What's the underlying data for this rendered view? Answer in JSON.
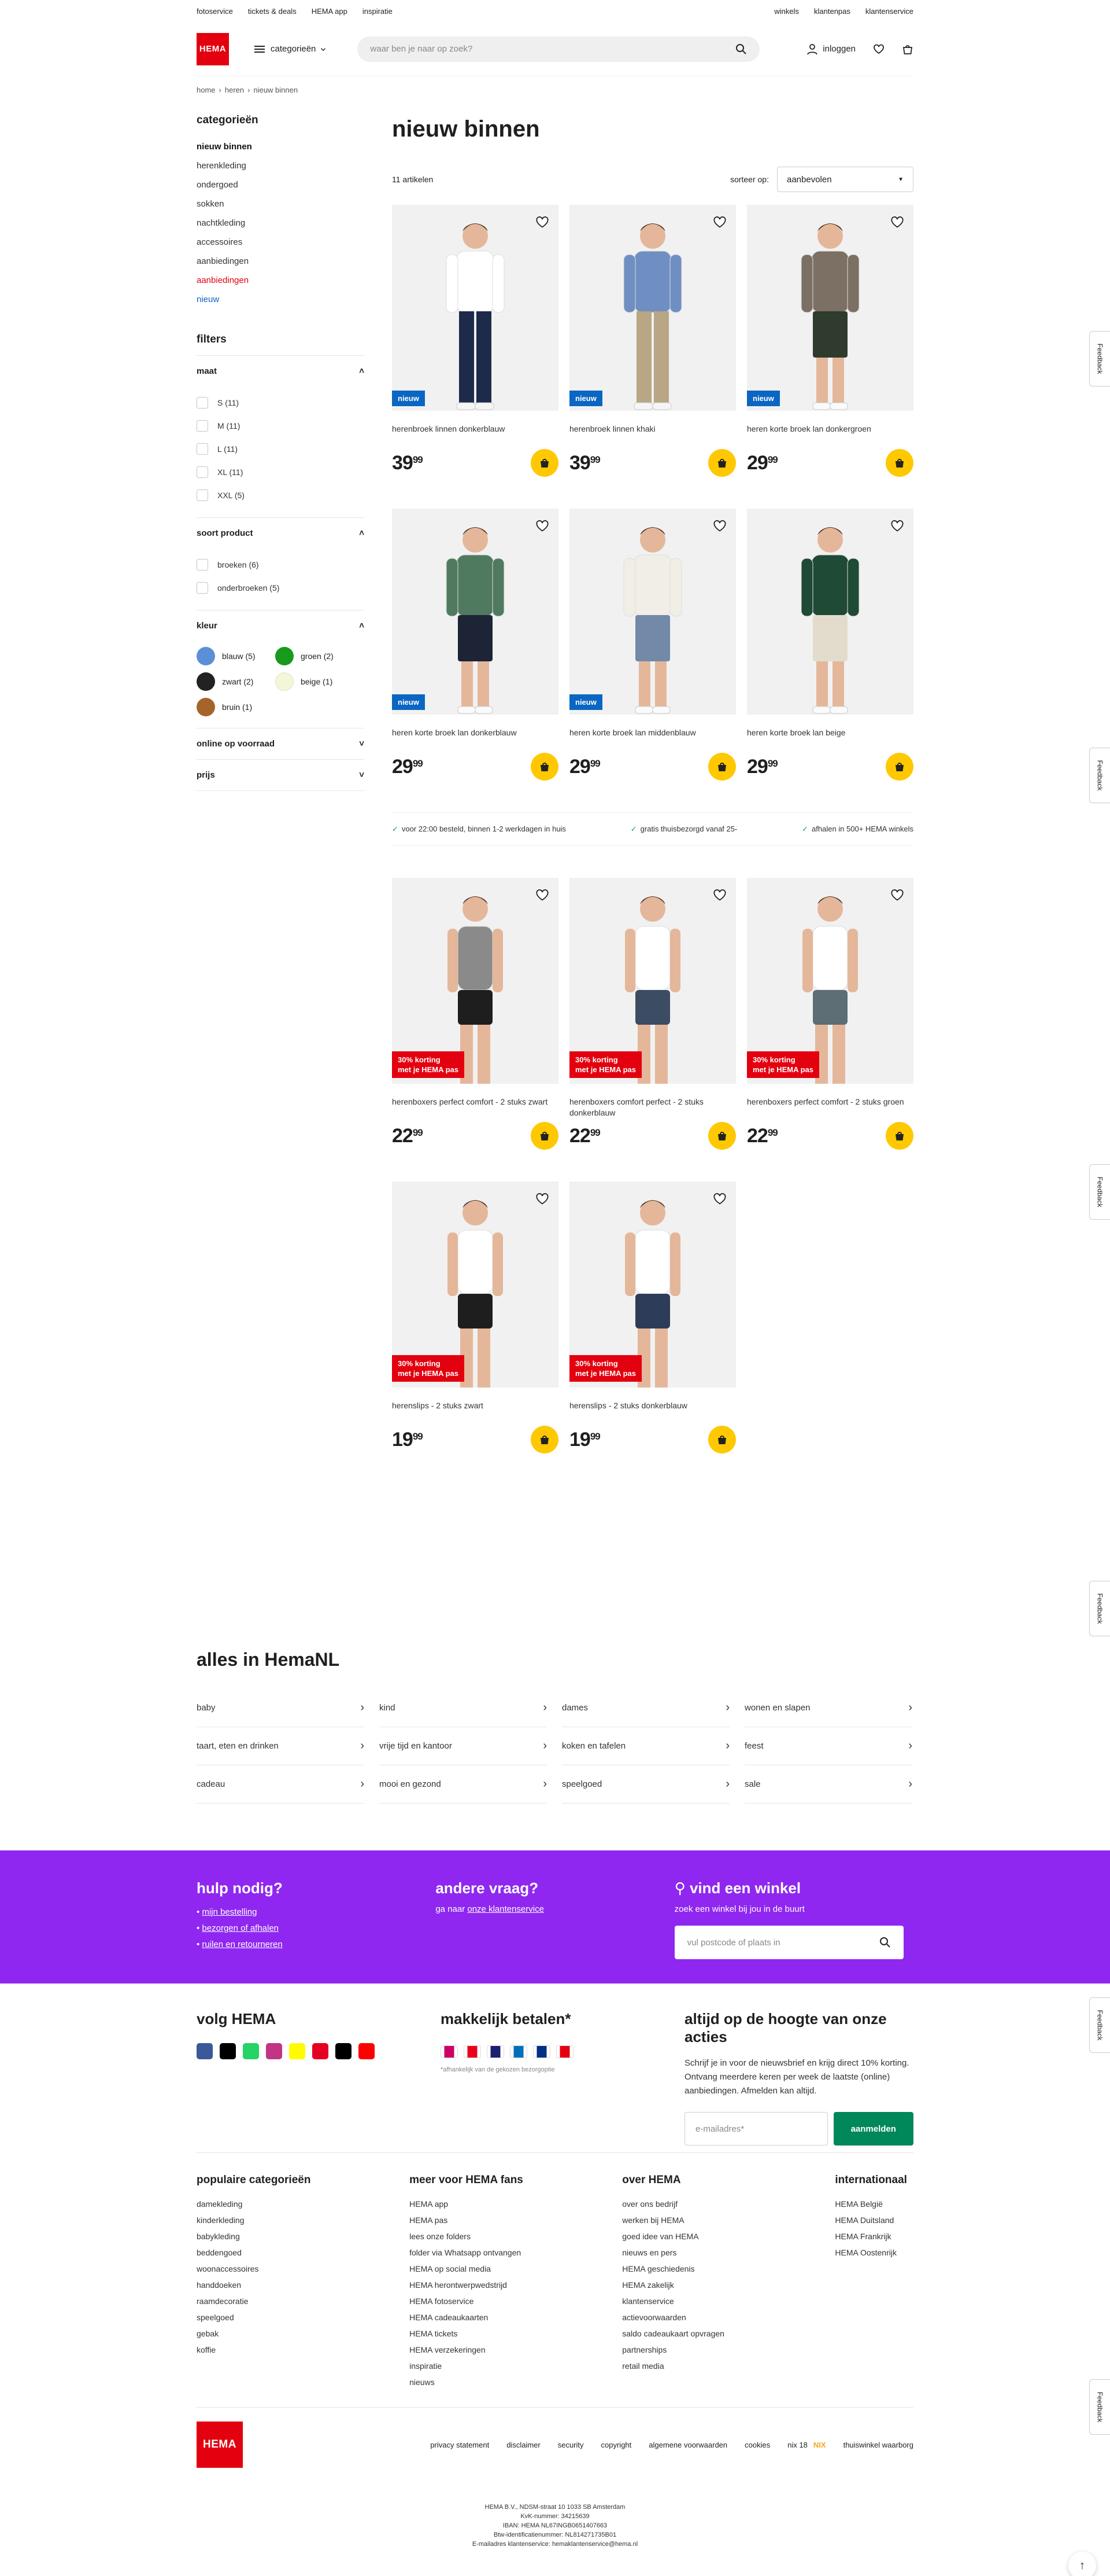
{
  "topbar": {
    "left": [
      "fotoservice",
      "tickets & deals",
      "HEMA app",
      "inspiratie"
    ],
    "right": [
      "winkels",
      "klantenpas",
      "klantenservice"
    ]
  },
  "header": {
    "logo": "HEMA",
    "categories_label": "categorieën",
    "search_placeholder": "waar ben je naar op zoek?",
    "login_label": "inloggen"
  },
  "breadcrumb": [
    "home",
    "heren",
    "nieuw binnen"
  ],
  "sidebar": {
    "title": "categorieën",
    "items": [
      {
        "label": "nieuw binnen",
        "style": "active"
      },
      {
        "label": "herenkleding",
        "style": ""
      },
      {
        "label": "ondergoed",
        "style": ""
      },
      {
        "label": "sokken",
        "style": ""
      },
      {
        "label": "nachtkleding",
        "style": ""
      },
      {
        "label": "accessoires",
        "style": ""
      },
      {
        "label": "aanbiedingen",
        "style": ""
      },
      {
        "label": "aanbiedingen",
        "style": "red"
      },
      {
        "label": "nieuw",
        "style": "blue"
      }
    ],
    "filters_title": "filters",
    "maat": {
      "title": "maat",
      "options": [
        "S (11)",
        "M (11)",
        "L (11)",
        "XL (11)",
        "XXL (5)"
      ]
    },
    "soort": {
      "title": "soort product",
      "options": [
        "broeken (6)",
        "onderbroeken (5)"
      ]
    },
    "kleur": {
      "title": "kleur",
      "options": [
        {
          "label": "blauw (5)",
          "color": "#5b8fd6"
        },
        {
          "label": "groen (2)",
          "color": "#179a1e"
        },
        {
          "label": "zwart (2)",
          "color": "#222222"
        },
        {
          "label": "beige (1)",
          "color": "#f3f6d8"
        },
        {
          "label": "bruin (1)",
          "color": "#a5652a"
        }
      ]
    },
    "online": {
      "title": "online op voorraad"
    },
    "prijs": {
      "title": "prijs"
    }
  },
  "main": {
    "title": "nieuw binnen",
    "count": "11 artikelen",
    "sort_label": "sorteer op:",
    "sort_value": "aanbevolen",
    "usps": [
      "voor 22:00 besteld, binnen 1-2 werkdagen in huis",
      "gratis thuisbezorgd vanaf 25-",
      "afhalen in 500+ HEMA winkels"
    ],
    "products": [
      {
        "name": "herenbroek linnen donkerblauw",
        "euro": "39",
        "cents": "99",
        "badge": "nieuw",
        "badge_type": "new",
        "shirt": "#ffffff",
        "bottom": "#1d2a4a",
        "long": true
      },
      {
        "name": "herenbroek linnen khaki",
        "euro": "39",
        "cents": "99",
        "badge": "nieuw",
        "badge_type": "new",
        "shirt": "#6f8fc2",
        "bottom": "#b9a684",
        "long": true
      },
      {
        "name": "heren korte broek lan donkergroen",
        "euro": "29",
        "cents": "99",
        "badge": "nieuw",
        "badge_type": "new",
        "shirt": "#7b7063",
        "bottom": "#2f3b2c",
        "long": false
      },
      {
        "name": "heren korte broek lan donkerblauw",
        "euro": "29",
        "cents": "99",
        "badge": "nieuw",
        "badge_type": "new",
        "shirt": "#4f7a5f",
        "bottom": "#1c2436",
        "long": false
      },
      {
        "name": "heren korte broek lan middenblauw",
        "euro": "29",
        "cents": "99",
        "badge": "nieuw",
        "badge_type": "new",
        "shirt": "#f1eee6",
        "bottom": "#7289a8",
        "long": false
      },
      {
        "name": "heren korte broek lan beige",
        "euro": "29",
        "cents": "99",
        "badge": "",
        "badge_type": "",
        "shirt": "#1f4a35",
        "bottom": "#e3dccd",
        "long": false
      },
      {
        "name": "herenboxers perfect comfort - 2 stuks zwart",
        "euro": "22",
        "cents": "99",
        "badge": "30% korting|met je HEMA pas",
        "badge_type": "disc",
        "shirt": "#8a8a8a",
        "bottom": "#1e1e1e",
        "long": false,
        "under": true
      },
      {
        "name": "herenboxers comfort perfect - 2 stuks donkerblauw",
        "euro": "22",
        "cents": "99",
        "badge": "30% korting|met je HEMA pas",
        "badge_type": "disc",
        "shirt": "#ffffff",
        "bottom": "#3b4c63",
        "long": false,
        "under": true
      },
      {
        "name": "herenboxers perfect comfort - 2 stuks groen",
        "euro": "22",
        "cents": "99",
        "badge": "30% korting|met je HEMA pas",
        "badge_type": "disc",
        "shirt": "#ffffff",
        "bottom": "#5d6e74",
        "long": false,
        "under": true
      },
      {
        "name": "herenslips - 2 stuks zwart",
        "euro": "19",
        "cents": "99",
        "badge": "30% korting|met je HEMA pas",
        "badge_type": "disc",
        "shirt": "#ffffff",
        "bottom": "#1e1e1e",
        "long": false,
        "under": true
      },
      {
        "name": "herenslips - 2 stuks donkerblauw",
        "euro": "19",
        "cents": "99",
        "badge": "30% korting|met je HEMA pas",
        "badge_type": "disc",
        "shirt": "#ffffff",
        "bottom": "#2d3c58",
        "long": false,
        "under": true
      }
    ]
  },
  "alles": {
    "title": "alles in HemaNL",
    "items": [
      "baby",
      "kind",
      "dames",
      "wonen en slapen",
      "taart, eten en drinken",
      "vrije tijd en kantoor",
      "koken en tafelen",
      "feest",
      "cadeau",
      "mooi en gezond",
      "speelgoed",
      "sale"
    ]
  },
  "help": {
    "title": "hulp nodig?",
    "links": [
      "mijn bestelling",
      "bezorgen of afhalen",
      "ruilen en retourneren"
    ],
    "q_title": "andere vraag?",
    "q_prefix": "ga naar ",
    "q_link": "onze klantenservice",
    "store_title": "vind een winkel",
    "store_sub": "zoek een winkel bij jou in de buurt",
    "store_placeholder": "vul postcode of plaats in"
  },
  "footer": {
    "follow_title": "volg HEMA",
    "social": [
      "#3b5998",
      "#000000",
      "#25d366",
      "#c13584",
      "#fffc00",
      "#e60023",
      "#000000",
      "#ff0000"
    ],
    "pay_title": "makkelijk betalen*",
    "pay_note": "*afhankelijk van de gekozen bezorgoptie",
    "pay_colors": [
      "#cc0066",
      "#eb001b",
      "#1a1f71",
      "#0070ba",
      "#003087",
      "#e3000f"
    ],
    "nl_title": "altijd op de hoogte van onze acties",
    "nl_text": "Schrijf je in voor de nieuwsbrief en krijg direct 10% korting. Ontvang meerdere keren per week de laatste (online) aanbiedingen. Afmelden kan altijd.",
    "nl_placeholder": "e-mailadres*",
    "nl_button": "aanmelden",
    "columns": [
      {
        "title": "populaire categorieën",
        "items": [
          "damekleding",
          "kinderkleding",
          "babykleding",
          "beddengoed",
          "woonaccessoires",
          "handdoeken",
          "raamdecoratie",
          "speelgoed",
          "gebak",
          "koffie"
        ]
      },
      {
        "title": "meer voor HEMA fans",
        "items": [
          "HEMA app",
          "HEMA pas",
          "lees onze folders",
          "folder via Whatsapp ontvangen",
          "HEMA op social media",
          "HEMA herontwerpwedstrijd",
          "HEMA fotoservice",
          "HEMA cadeaukaarten",
          "HEMA tickets",
          "HEMA verzekeringen",
          "inspiratie",
          "nieuws"
        ]
      },
      {
        "title": "over HEMA",
        "items": [
          "over ons bedrijf",
          "werken bij HEMA",
          "goed idee van HEMA",
          "nieuws en pers",
          "HEMA geschiedenis",
          "HEMA zakelijk",
          "klantenservice",
          "actievoorwaarden",
          "saldo cadeaukaart opvragen",
          "partnerships",
          "retail media"
        ]
      },
      {
        "title": "internationaal",
        "items": [
          "HEMA België",
          "HEMA Duitsland",
          "HEMA Frankrijk",
          "HEMA Oostenrijk"
        ]
      }
    ],
    "bottom_links": [
      "privacy statement",
      "disclaimer",
      "security",
      "copyright",
      "algemene voorwaarden",
      "cookies",
      "nix 18",
      "thuiswinkel waarborg"
    ],
    "nix": "NIX",
    "legal": [
      "HEMA B.V., NDSM-straat 10 1033 SB Amsterdam",
      "KvK-nummer: 34215639",
      "IBAN: HEMA NL67INGB0651407663",
      "Btw-identificatienummer: NL814271735B01",
      "E-mailadres klantenservice: hemaklantenservice@hema.nl"
    ],
    "feedback": "Feedback"
  }
}
